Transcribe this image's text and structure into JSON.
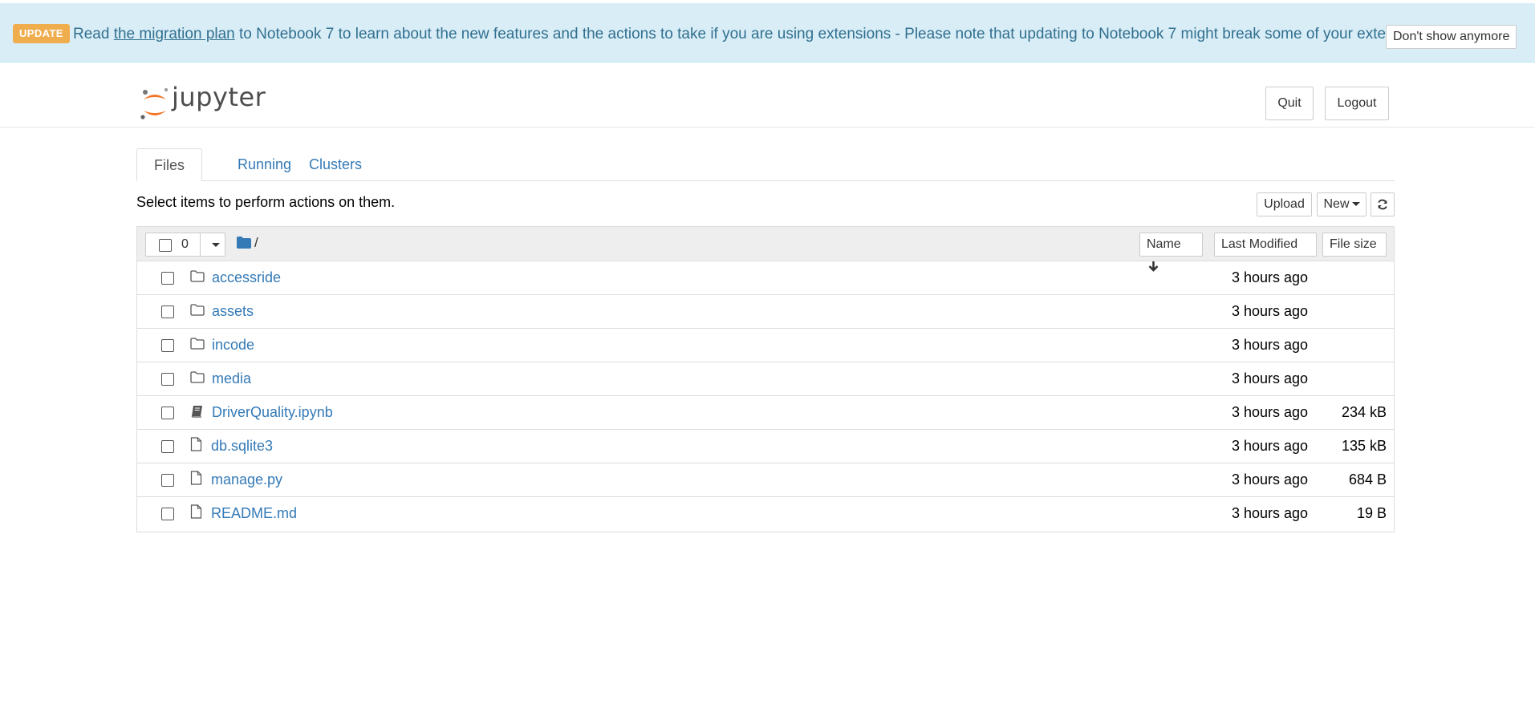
{
  "banner": {
    "badge": "UPDATE",
    "text_before": "Read",
    "link": "the migration plan",
    "text_after": "to Notebook 7 to learn about the new features and the actions to take if you are using extensions - Please note that updating to Notebook 7 might break some of your extensions.",
    "dismiss_label": "Don't show anymore"
  },
  "header": {
    "logo_text": "jupyter",
    "quit_label": "Quit",
    "logout_label": "Logout"
  },
  "tabs": [
    {
      "label": "Files",
      "active": true
    },
    {
      "label": "Running",
      "active": false
    },
    {
      "label": "Clusters",
      "active": false
    }
  ],
  "toolbar": {
    "hint": "Select items to perform actions on them.",
    "upload_label": "Upload",
    "new_label": "New"
  },
  "list_header": {
    "selected_count": "0",
    "path": "/",
    "name_label": "Name",
    "modified_label": "Last Modified",
    "size_label": "File size"
  },
  "files": [
    {
      "name": "accessride",
      "type": "folder",
      "modified": "3 hours ago",
      "size": ""
    },
    {
      "name": "assets",
      "type": "folder",
      "modified": "3 hours ago",
      "size": ""
    },
    {
      "name": "incode",
      "type": "folder",
      "modified": "3 hours ago",
      "size": ""
    },
    {
      "name": "media",
      "type": "folder",
      "modified": "3 hours ago",
      "size": ""
    },
    {
      "name": "DriverQuality.ipynb",
      "type": "notebook",
      "modified": "3 hours ago",
      "size": "234 kB"
    },
    {
      "name": "db.sqlite3",
      "type": "file",
      "modified": "3 hours ago",
      "size": "135 kB"
    },
    {
      "name": "manage.py",
      "type": "file",
      "modified": "3 hours ago",
      "size": "684 B"
    },
    {
      "name": "README.md",
      "type": "file",
      "modified": "3 hours ago",
      "size": "19 B"
    }
  ],
  "colors": {
    "link": "#337ab7",
    "banner_bg": "#d9edf7",
    "banner_text": "#31708f",
    "badge": "#f0ad4e",
    "jupyter_orange": "#f37626"
  }
}
